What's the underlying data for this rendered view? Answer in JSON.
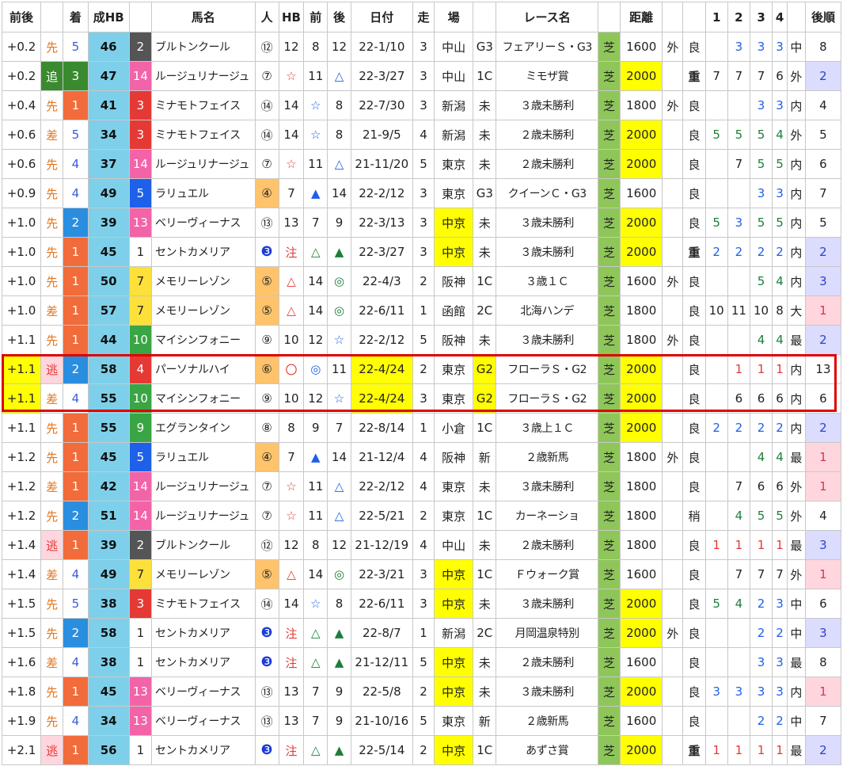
{
  "headers": [
    "前後",
    "",
    "着",
    "成HB",
    "",
    "馬名",
    "人",
    "HB",
    "前",
    "後",
    "日付",
    "走",
    "場",
    "",
    "レース名",
    "",
    "距離",
    "",
    "",
    "1",
    "2",
    "3",
    "4",
    "",
    "後順"
  ],
  "colors": {
    "yellow": "#ffff00",
    "turf_green": "#8fc65a",
    "hb_cyan": "#7ed0ea",
    "frame": {
      "1": "#ffffff",
      "2": "#555555",
      "3": "#e53935",
      "4": "#1e88e5",
      "5": "#fde03a",
      "6": "#43a047",
      "7": "#fb8c00",
      "8": "#f48fb1"
    },
    "chaku": {
      "1": "#f26b3a",
      "2": "#2aa37a",
      "3": "#3c8d2f",
      "4": "#4a6fd8",
      "5": "#4a6fd8",
      "6": "#ffffff"
    }
  },
  "rows": [
    {
      "zengo": "+0.2",
      "kyaku": "先",
      "chaku": "5",
      "seihb": "46",
      "waku": "2",
      "name": "ブルトンクール",
      "ninki": "⑫",
      "hb": "12",
      "mae": "8",
      "ato": "12",
      "date": "22-1/10",
      "so": "3",
      "ba": "中山",
      "cls": "G3",
      "race": "フェアリーＳ・G3",
      "shiba": "芝",
      "dist": "1600",
      "dist_y": false,
      "gai": "外",
      "baba": "良",
      "c1": "",
      "c2": "3",
      "c3": "3",
      "c4": "3",
      "pos": "中",
      "kojun": "8",
      "kojun_style": "",
      "hl": false
    },
    {
      "zengo": "+0.2",
      "kyaku": "追",
      "chaku": "3",
      "seihb": "47",
      "waku": "14",
      "name": "ルージュリナージュ",
      "ninki": "⑦",
      "hb": "☆",
      "mae": "11",
      "ato": "△",
      "date": "22-3/27",
      "so": "3",
      "ba": "中山",
      "cls": "1C",
      "race": "ミモザ賞",
      "shiba": "芝",
      "dist": "2000",
      "dist_y": true,
      "gai": "",
      "baba": "重",
      "c1": "7",
      "c2": "7",
      "c3": "7",
      "c4": "6",
      "pos": "外",
      "kojun": "2",
      "kojun_style": "lav",
      "hl": false
    },
    {
      "zengo": "+0.4",
      "kyaku": "先",
      "chaku": "1",
      "seihb": "41",
      "waku": "3",
      "name": "ミナモトフェイス",
      "ninki": "⑭",
      "hb": "14",
      "mae": "☆",
      "ato": "8",
      "date": "22-7/30",
      "so": "3",
      "ba": "新潟",
      "cls": "未",
      "race": "３歳未勝利",
      "shiba": "芝",
      "dist": "1800",
      "dist_y": false,
      "gai": "外",
      "baba": "良",
      "c1": "",
      "c2": "",
      "c3": "3",
      "c4": "3",
      "pos": "内",
      "kojun": "4",
      "kojun_style": "",
      "hl": false
    },
    {
      "zengo": "+0.6",
      "kyaku": "差",
      "chaku": "5",
      "seihb": "34",
      "waku": "3",
      "name": "ミナモトフェイス",
      "ninki": "⑭",
      "hb": "14",
      "mae": "☆",
      "ato": "8",
      "date": "21-9/5",
      "so": "4",
      "ba": "新潟",
      "cls": "未",
      "race": "２歳未勝利",
      "shiba": "芝",
      "dist": "2000",
      "dist_y": true,
      "gai": "",
      "baba": "良",
      "c1": "5",
      "c2": "5",
      "c3": "5",
      "c4": "4",
      "pos": "外",
      "kojun": "5",
      "kojun_style": "",
      "hl": false
    },
    {
      "zengo": "+0.6",
      "kyaku": "先",
      "chaku": "4",
      "seihb": "37",
      "waku": "14",
      "name": "ルージュリナージュ",
      "ninki": "⑦",
      "hb": "☆",
      "mae": "11",
      "ato": "△",
      "date": "21-11/20",
      "so": "5",
      "ba": "東京",
      "cls": "未",
      "race": "２歳未勝利",
      "shiba": "芝",
      "dist": "2000",
      "dist_y": true,
      "gai": "",
      "baba": "良",
      "c1": "",
      "c2": "7",
      "c3": "5",
      "c4": "5",
      "pos": "内",
      "kojun": "6",
      "kojun_style": "",
      "hl": false
    },
    {
      "zengo": "+0.9",
      "kyaku": "先",
      "chaku": "4",
      "seihb": "49",
      "waku": "5",
      "name": "ラリュエル",
      "ninki": "④",
      "hb": "7",
      "mae": "▲",
      "ato": "14",
      "date": "22-2/12",
      "so": "3",
      "ba": "東京",
      "cls": "G3",
      "race": "クイーンＣ・G3",
      "shiba": "芝",
      "dist": "1600",
      "dist_y": false,
      "gai": "",
      "baba": "良",
      "c1": "",
      "c2": "",
      "c3": "3",
      "c4": "3",
      "pos": "内",
      "kojun": "7",
      "kojun_style": "",
      "hl": false
    },
    {
      "zengo": "+1.0",
      "kyaku": "先",
      "chaku": "2",
      "seihb": "39",
      "waku": "13",
      "name": "ベリーヴィーナス",
      "ninki": "⑬",
      "hb": "13",
      "mae": "7",
      "ato": "9",
      "date": "22-3/13",
      "so": "3",
      "ba": "中京",
      "cls": "未",
      "race": "３歳未勝利",
      "shiba": "芝",
      "dist": "2000",
      "dist_y": true,
      "gai": "",
      "baba": "良",
      "c1": "5",
      "c2": "3",
      "c3": "5",
      "c4": "5",
      "pos": "内",
      "kojun": "5",
      "kojun_style": "",
      "hl": false
    },
    {
      "zengo": "+1.0",
      "kyaku": "先",
      "chaku": "1",
      "seihb": "45",
      "waku": "1",
      "name": "セントカメリア",
      "ninki": "❸",
      "hb": "注",
      "mae": "△",
      "ato": "▲",
      "date": "22-3/27",
      "so": "3",
      "ba": "中京",
      "cls": "未",
      "race": "３歳未勝利",
      "shiba": "芝",
      "dist": "2000",
      "dist_y": true,
      "gai": "",
      "baba": "重",
      "c1": "2",
      "c2": "2",
      "c3": "2",
      "c4": "2",
      "pos": "内",
      "kojun": "2",
      "kojun_style": "lav",
      "hl": false
    },
    {
      "zengo": "+1.0",
      "kyaku": "先",
      "chaku": "1",
      "seihb": "50",
      "waku": "7",
      "name": "メモリーレゾン",
      "ninki": "⑤",
      "hb": "△",
      "mae": "14",
      "ato": "◎",
      "date": "22-4/3",
      "so": "2",
      "ba": "阪神",
      "cls": "1C",
      "race": "３歳１Ｃ",
      "shiba": "芝",
      "dist": "1600",
      "dist_y": false,
      "gai": "外",
      "baba": "良",
      "c1": "",
      "c2": "",
      "c3": "5",
      "c4": "4",
      "pos": "内",
      "kojun": "3",
      "kojun_style": "lav",
      "hl": false
    },
    {
      "zengo": "+1.0",
      "kyaku": "差",
      "chaku": "1",
      "seihb": "57",
      "waku": "7",
      "name": "メモリーレゾン",
      "ninki": "⑤",
      "hb": "△",
      "mae": "14",
      "ato": "◎",
      "date": "22-6/11",
      "so": "1",
      "ba": "函館",
      "cls": "2C",
      "race": "北海ハンデ",
      "shiba": "芝",
      "dist": "1800",
      "dist_y": false,
      "gai": "",
      "baba": "良",
      "c1": "10",
      "c2": "11",
      "c3": "10",
      "c4": "8",
      "pos": "大",
      "kojun": "1",
      "kojun_style": "pink",
      "hl": false
    },
    {
      "zengo": "+1.1",
      "kyaku": "先",
      "chaku": "1",
      "seihb": "44",
      "waku": "10",
      "name": "マイシンフォニー",
      "ninki": "⑨",
      "hb": "10",
      "mae": "12",
      "ato": "☆",
      "date": "22-2/12",
      "so": "5",
      "ba": "阪神",
      "cls": "未",
      "race": "３歳未勝利",
      "shiba": "芝",
      "dist": "1800",
      "dist_y": false,
      "gai": "外",
      "baba": "良",
      "c1": "",
      "c2": "",
      "c3": "4",
      "c4": "4",
      "pos": "最",
      "kojun": "2",
      "kojun_style": "lav",
      "hl": false
    },
    {
      "zengo": "+1.1",
      "kyaku": "逃",
      "chaku": "2",
      "seihb": "58",
      "waku": "4",
      "name": "パーソナルハイ",
      "ninki": "⑥",
      "hb": "〇",
      "mae": "◎",
      "ato": "11",
      "date": "22-4/24",
      "so": "2",
      "ba": "東京",
      "cls": "G2",
      "race": "フローラＳ・G2",
      "shiba": "芝",
      "dist": "2000",
      "dist_y": true,
      "gai": "",
      "baba": "良",
      "c1": "",
      "c2": "1",
      "c3": "1",
      "c4": "1",
      "pos": "内",
      "kojun": "13",
      "kojun_style": "",
      "hl": true
    },
    {
      "zengo": "+1.1",
      "kyaku": "差",
      "chaku": "4",
      "seihb": "55",
      "waku": "10",
      "name": "マイシンフォニー",
      "ninki": "⑨",
      "hb": "10",
      "mae": "12",
      "ato": "☆",
      "date": "22-4/24",
      "so": "3",
      "ba": "東京",
      "cls": "G2",
      "race": "フローラＳ・G2",
      "shiba": "芝",
      "dist": "2000",
      "dist_y": true,
      "gai": "",
      "baba": "良",
      "c1": "",
      "c2": "6",
      "c3": "6",
      "c4": "6",
      "pos": "内",
      "kojun": "6",
      "kojun_style": "",
      "hl": true
    },
    {
      "zengo": "+1.1",
      "kyaku": "先",
      "chaku": "1",
      "seihb": "55",
      "waku": "9",
      "name": "エグランタイン",
      "ninki": "⑧",
      "hb": "8",
      "mae": "9",
      "ato": "7",
      "date": "22-8/14",
      "so": "1",
      "ba": "小倉",
      "cls": "1C",
      "race": "３歳上１Ｃ",
      "shiba": "芝",
      "dist": "2000",
      "dist_y": true,
      "gai": "",
      "baba": "良",
      "c1": "2",
      "c2": "2",
      "c3": "2",
      "c4": "2",
      "pos": "内",
      "kojun": "2",
      "kojun_style": "lav",
      "hl": false
    },
    {
      "zengo": "+1.2",
      "kyaku": "先",
      "chaku": "1",
      "seihb": "45",
      "waku": "5",
      "name": "ラリュエル",
      "ninki": "④",
      "hb": "7",
      "mae": "▲",
      "ato": "14",
      "date": "21-12/4",
      "so": "4",
      "ba": "阪神",
      "cls": "新",
      "race": "２歳新馬",
      "shiba": "芝",
      "dist": "1800",
      "dist_y": false,
      "gai": "外",
      "baba": "良",
      "c1": "",
      "c2": "",
      "c3": "4",
      "c4": "4",
      "pos": "最",
      "kojun": "1",
      "kojun_style": "pink",
      "hl": false
    },
    {
      "zengo": "+1.2",
      "kyaku": "差",
      "chaku": "1",
      "seihb": "42",
      "waku": "14",
      "name": "ルージュリナージュ",
      "ninki": "⑦",
      "hb": "☆",
      "mae": "11",
      "ato": "△",
      "date": "22-2/12",
      "so": "4",
      "ba": "東京",
      "cls": "未",
      "race": "３歳未勝利",
      "shiba": "芝",
      "dist": "1800",
      "dist_y": false,
      "gai": "",
      "baba": "良",
      "c1": "",
      "c2": "7",
      "c3": "6",
      "c4": "6",
      "pos": "外",
      "kojun": "1",
      "kojun_style": "pink",
      "hl": false
    },
    {
      "zengo": "+1.2",
      "kyaku": "先",
      "chaku": "2",
      "seihb": "51",
      "waku": "14",
      "name": "ルージュリナージュ",
      "ninki": "⑦",
      "hb": "☆",
      "mae": "11",
      "ato": "△",
      "date": "22-5/21",
      "so": "2",
      "ba": "東京",
      "cls": "1C",
      "race": "カーネーショ",
      "shiba": "芝",
      "dist": "1800",
      "dist_y": false,
      "gai": "",
      "baba": "稍",
      "c1": "",
      "c2": "4",
      "c3": "5",
      "c4": "5",
      "pos": "外",
      "kojun": "4",
      "kojun_style": "",
      "hl": false
    },
    {
      "zengo": "+1.4",
      "kyaku": "逃",
      "chaku": "1",
      "seihb": "39",
      "waku": "2",
      "name": "ブルトンクール",
      "ninki": "⑫",
      "hb": "12",
      "mae": "8",
      "ato": "12",
      "date": "21-12/19",
      "so": "4",
      "ba": "中山",
      "cls": "未",
      "race": "２歳未勝利",
      "shiba": "芝",
      "dist": "1800",
      "dist_y": false,
      "gai": "",
      "baba": "良",
      "c1": "1",
      "c2": "1",
      "c3": "1",
      "c4": "1",
      "pos": "最",
      "kojun": "3",
      "kojun_style": "lav",
      "hl": false
    },
    {
      "zengo": "+1.4",
      "kyaku": "差",
      "chaku": "4",
      "seihb": "49",
      "waku": "7",
      "name": "メモリーレゾン",
      "ninki": "⑤",
      "hb": "△",
      "mae": "14",
      "ato": "◎",
      "date": "22-3/21",
      "so": "3",
      "ba": "中京",
      "cls": "1C",
      "race": "Ｆウォーク賞",
      "shiba": "芝",
      "dist": "1600",
      "dist_y": false,
      "gai": "",
      "baba": "良",
      "c1": "",
      "c2": "7",
      "c3": "7",
      "c4": "7",
      "pos": "外",
      "kojun": "1",
      "kojun_style": "pink",
      "hl": false
    },
    {
      "zengo": "+1.5",
      "kyaku": "先",
      "chaku": "5",
      "seihb": "38",
      "waku": "3",
      "name": "ミナモトフェイス",
      "ninki": "⑭",
      "hb": "14",
      "mae": "☆",
      "ato": "8",
      "date": "22-6/11",
      "so": "3",
      "ba": "中京",
      "cls": "未",
      "race": "３歳未勝利",
      "shiba": "芝",
      "dist": "2000",
      "dist_y": true,
      "gai": "",
      "baba": "良",
      "c1": "5",
      "c2": "4",
      "c3": "2",
      "c4": "3",
      "pos": "中",
      "kojun": "6",
      "kojun_style": "",
      "hl": false
    },
    {
      "zengo": "+1.5",
      "kyaku": "先",
      "chaku": "2",
      "seihb": "58",
      "waku": "1",
      "name": "セントカメリア",
      "ninki": "❸",
      "hb": "注",
      "mae": "△",
      "ato": "▲",
      "date": "22-8/7",
      "so": "1",
      "ba": "新潟",
      "cls": "2C",
      "race": "月岡温泉特別",
      "shiba": "芝",
      "dist": "2000",
      "dist_y": true,
      "gai": "外",
      "baba": "良",
      "c1": "",
      "c2": "",
      "c3": "2",
      "c4": "2",
      "pos": "中",
      "kojun": "3",
      "kojun_style": "lav",
      "hl": false
    },
    {
      "zengo": "+1.6",
      "kyaku": "差",
      "chaku": "4",
      "seihb": "38",
      "waku": "1",
      "name": "セントカメリア",
      "ninki": "❸",
      "hb": "注",
      "mae": "△",
      "ato": "▲",
      "date": "21-12/11",
      "so": "5",
      "ba": "中京",
      "cls": "未",
      "race": "２歳未勝利",
      "shiba": "芝",
      "dist": "1600",
      "dist_y": false,
      "gai": "",
      "baba": "良",
      "c1": "",
      "c2": "",
      "c3": "3",
      "c4": "3",
      "pos": "最",
      "kojun": "8",
      "kojun_style": "",
      "hl": false
    },
    {
      "zengo": "+1.8",
      "kyaku": "先",
      "chaku": "1",
      "seihb": "45",
      "waku": "13",
      "name": "ベリーヴィーナス",
      "ninki": "⑬",
      "hb": "13",
      "mae": "7",
      "ato": "9",
      "date": "22-5/8",
      "so": "2",
      "ba": "中京",
      "cls": "未",
      "race": "３歳未勝利",
      "shiba": "芝",
      "dist": "2000",
      "dist_y": true,
      "gai": "",
      "baba": "良",
      "c1": "3",
      "c2": "3",
      "c3": "3",
      "c4": "3",
      "pos": "内",
      "kojun": "1",
      "kojun_style": "pink",
      "hl": false
    },
    {
      "zengo": "+1.9",
      "kyaku": "先",
      "chaku": "4",
      "seihb": "34",
      "waku": "13",
      "name": "ベリーヴィーナス",
      "ninki": "⑬",
      "hb": "13",
      "mae": "7",
      "ato": "9",
      "date": "21-10/16",
      "so": "5",
      "ba": "東京",
      "cls": "新",
      "race": "２歳新馬",
      "shiba": "芝",
      "dist": "1600",
      "dist_y": false,
      "gai": "",
      "baba": "良",
      "c1": "",
      "c2": "",
      "c3": "2",
      "c4": "2",
      "pos": "中",
      "kojun": "7",
      "kojun_style": "",
      "hl": false
    },
    {
      "zengo": "+2.1",
      "kyaku": "逃",
      "chaku": "1",
      "seihb": "56",
      "waku": "1",
      "name": "セントカメリア",
      "ninki": "❸",
      "hb": "注",
      "mae": "△",
      "ato": "▲",
      "date": "22-5/14",
      "so": "2",
      "ba": "中京",
      "cls": "1C",
      "race": "あずさ賞",
      "shiba": "芝",
      "dist": "2000",
      "dist_y": true,
      "gai": "",
      "baba": "重",
      "c1": "1",
      "c2": "1",
      "c3": "1",
      "c4": "1",
      "pos": "最",
      "kojun": "2",
      "kojun_style": "lav",
      "hl": false
    }
  ]
}
